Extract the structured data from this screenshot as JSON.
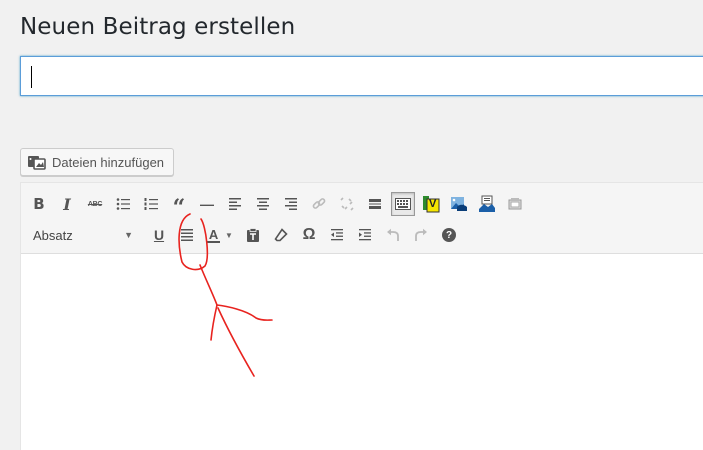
{
  "page": {
    "title": "Neuen Beitrag erstellen"
  },
  "title_field": {
    "value": "",
    "placeholder": ""
  },
  "media": {
    "button_label": "Dateien hinzufügen",
    "icon": "media-add-icon"
  },
  "toolbar": {
    "row1": [
      {
        "name": "bold-button",
        "icon": "bold-icon",
        "glyph": "B"
      },
      {
        "name": "italic-button",
        "icon": "italic-icon",
        "glyph": "I"
      },
      {
        "name": "strikethrough-button",
        "icon": "strikethrough-icon",
        "glyph": "ABC"
      },
      {
        "name": "bullet-list-button",
        "icon": "bullet-list-icon"
      },
      {
        "name": "numbered-list-button",
        "icon": "numbered-list-icon"
      },
      {
        "name": "blockquote-button",
        "icon": "blockquote-icon",
        "glyph": "“"
      },
      {
        "name": "horizontal-line-button",
        "icon": "horizontal-line-icon",
        "glyph": "—"
      },
      {
        "name": "align-left-button",
        "icon": "align-left-icon"
      },
      {
        "name": "align-center-button",
        "icon": "align-center-icon"
      },
      {
        "name": "align-right-button",
        "icon": "align-right-icon"
      },
      {
        "name": "insert-link-button",
        "icon": "link-icon"
      },
      {
        "name": "remove-link-button",
        "icon": "unlink-icon"
      },
      {
        "name": "read-more-button",
        "icon": "read-more-icon"
      },
      {
        "name": "toolbar-toggle-button",
        "icon": "keyboard-icon"
      },
      {
        "name": "plugin-v-button",
        "icon": "plugin-v-icon",
        "glyph": "V"
      },
      {
        "name": "insert-image-button",
        "icon": "image-icon"
      },
      {
        "name": "insert-document-button",
        "icon": "document-image-icon"
      },
      {
        "name": "insert-gallery-button",
        "icon": "gallery-icon"
      }
    ],
    "row2": [
      {
        "name": "underline-button",
        "icon": "underline-icon",
        "glyph": "U"
      },
      {
        "name": "justify-button",
        "icon": "justify-icon"
      },
      {
        "name": "text-color-button",
        "icon": "text-color-icon",
        "glyph": "A"
      },
      {
        "name": "paste-text-button",
        "icon": "paste-text-icon"
      },
      {
        "name": "clear-formatting-button",
        "icon": "eraser-icon"
      },
      {
        "name": "special-character-button",
        "icon": "omega-icon",
        "glyph": "Ω"
      },
      {
        "name": "outdent-button",
        "icon": "outdent-icon"
      },
      {
        "name": "indent-button",
        "icon": "indent-icon"
      },
      {
        "name": "undo-button",
        "icon": "undo-icon"
      },
      {
        "name": "redo-button",
        "icon": "redo-icon"
      },
      {
        "name": "help-button",
        "icon": "help-icon",
        "glyph": "?"
      }
    ],
    "format_select": {
      "value": "Absatz"
    }
  },
  "colors": {
    "annotation": "#e8231f",
    "focus_border": "#5b9dd9",
    "toolbar_bg": "#f5f5f5",
    "icon": "#555555"
  }
}
